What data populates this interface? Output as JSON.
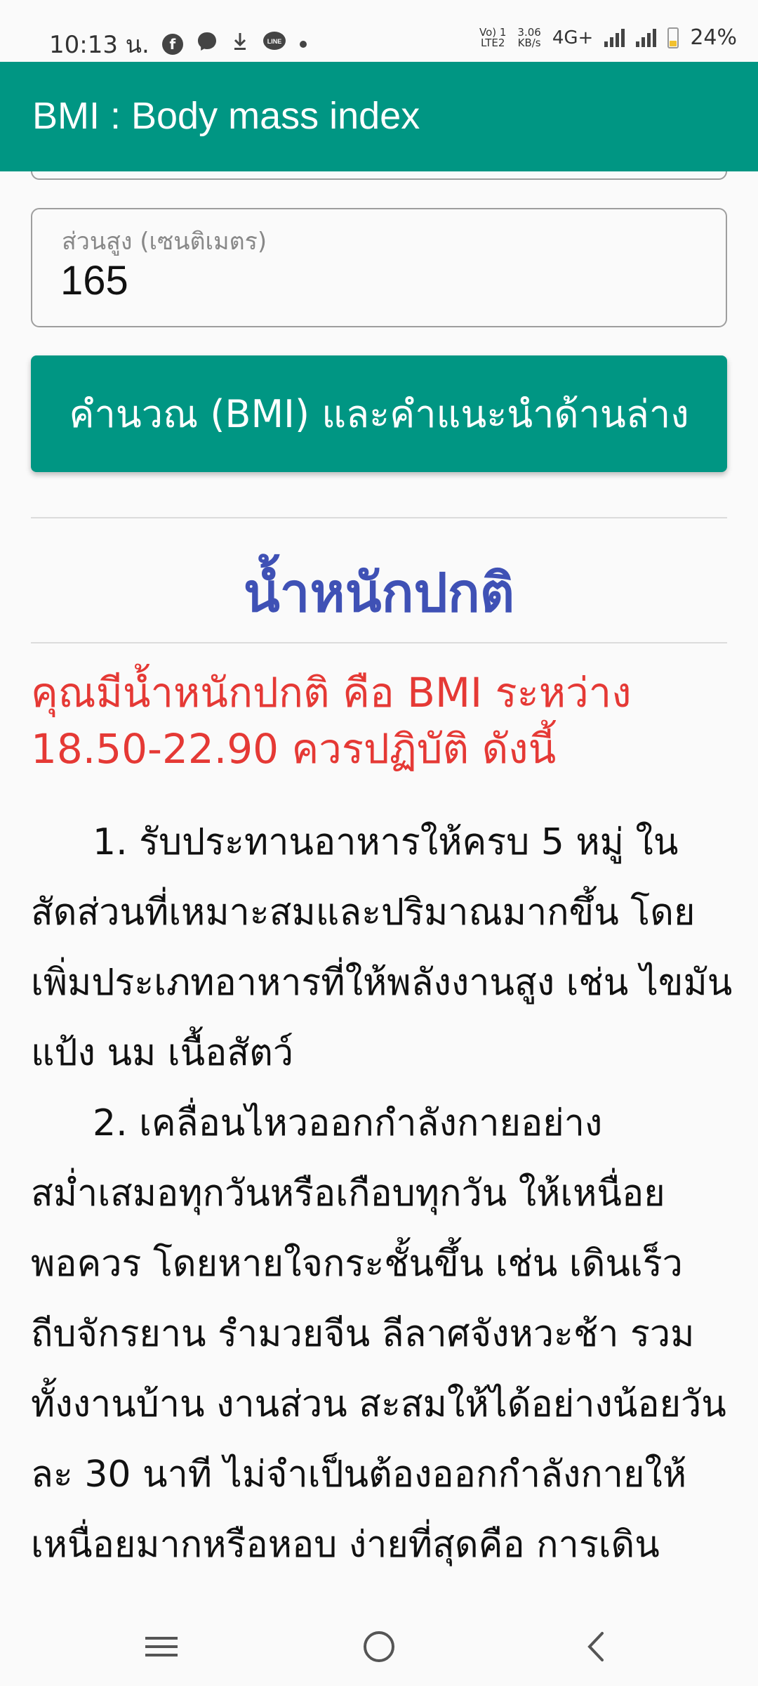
{
  "status_bar": {
    "time": "10:13 น.",
    "network_label": "4G+",
    "speed_value": "3.06",
    "speed_unit": "KB/s",
    "volte_line1": "Vo) 1",
    "volte_line2": "LTE2",
    "battery": "24%"
  },
  "app_bar": {
    "title": "BMI : Body mass index"
  },
  "form": {
    "height_label": "ส่วนสูง (เซนติเมตร)",
    "height_value": "165",
    "calculate_label": "คำนวณ (BMI) และคำแนะนำด้านล่าง"
  },
  "result": {
    "title": "น้ำหนักปกติ",
    "description": "คุณมีน้ำหนักปกติ คือ BMI ระหว่าง 18.50-22.90 ควรปฏิบัติ ดังนี้",
    "advice": [
      "1. รับประทานอาหารให้ครบ 5 หมู่ ในสัดส่วนที่เหมาะสมและปริมาณมากขึ้น โดยเพิ่มประเภทอาหารที่ให้พลังงานสูง เช่น ไขมัน แป้ง นม เนื้อสัตว์",
      "2. เคลื่อนไหวออกกำลังกายอย่างสม่ำเสมอทุกวันหรือเกือบทุกวัน ให้เหนื่อยพอควร โดยหายใจกระชั้นขึ้น เช่น เดินเร็ว ถีบจักรยาน รำมวยจีน ลีลาศจังหวะช้า รวมทั้งงานบ้าน งานส่วน สะสมให้ได้อย่างน้อยวันละ 30 นาที ไม่จำเป็นต้องออกกำลังกายให้เหนื่อยมากหรือหอบ ง่ายที่สุดคือ การเดิน"
    ]
  },
  "colors": {
    "primary": "#009683",
    "result_title": "#3f51b5",
    "result_desc": "#e53935"
  }
}
